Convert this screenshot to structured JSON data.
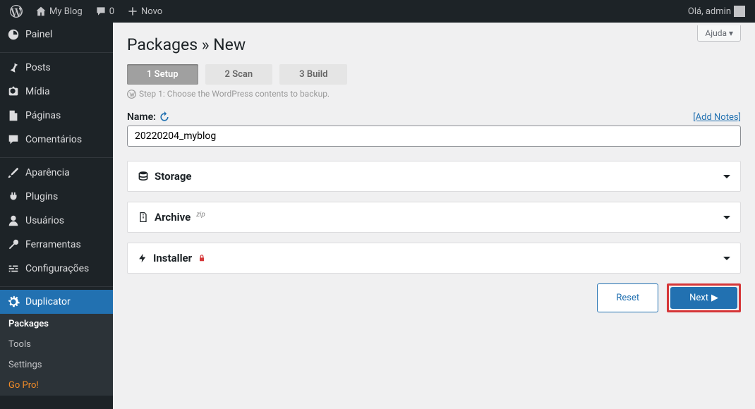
{
  "topbar": {
    "site_name": "My Blog",
    "comments_count": "0",
    "new_label": "Novo",
    "greeting": "Olá, admin"
  },
  "sidebar": {
    "items": [
      {
        "label": "Painel",
        "icon": "dashboard"
      },
      {
        "label": "Posts",
        "icon": "pin"
      },
      {
        "label": "Mídia",
        "icon": "media"
      },
      {
        "label": "Páginas",
        "icon": "page"
      },
      {
        "label": "Comentários",
        "icon": "comment"
      },
      {
        "label": "Aparência",
        "icon": "brush"
      },
      {
        "label": "Plugins",
        "icon": "plug"
      },
      {
        "label": "Usuários",
        "icon": "user"
      },
      {
        "label": "Ferramentas",
        "icon": "wrench"
      },
      {
        "label": "Configurações",
        "icon": "sliders"
      },
      {
        "label": "Duplicator",
        "icon": "gear"
      }
    ],
    "submenu": {
      "packages": "Packages",
      "tools": "Tools",
      "settings": "Settings",
      "gopro": "Go Pro!"
    }
  },
  "main": {
    "help": "Ajuda",
    "title": "Packages » New",
    "steps": {
      "s1": "1  Setup",
      "s2": "2  Scan",
      "s3": "3  Build",
      "desc": "Step 1: Choose the WordPress contents to backup."
    },
    "name_label": "Name:",
    "add_notes": "[Add Notes]",
    "name_value": "20220204_myblog",
    "panels": {
      "storage": "Storage",
      "archive": "Archive",
      "archive_sup": "zip",
      "installer": "Installer"
    },
    "buttons": {
      "reset": "Reset",
      "next": "Next"
    }
  }
}
